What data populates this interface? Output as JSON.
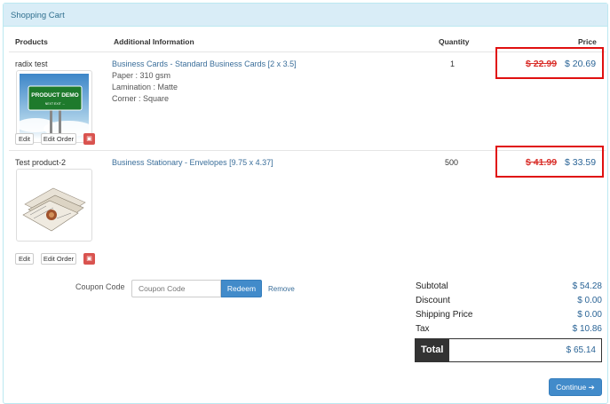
{
  "panel": {
    "title": "Shopping Cart"
  },
  "table": {
    "headers": {
      "products": "Products",
      "info": "Additional Information",
      "quantity": "Quantity",
      "price": "Price"
    },
    "rows": [
      {
        "name": "radix test",
        "thumb_text": "PRODUCT DEMO",
        "thumb_subtext": "NEXT EXIT →",
        "title": "Business Cards - Standard Business Cards [2 x 3.5]",
        "details": [
          "Paper : 310 gsm",
          "Lamination : Matte",
          "Corner : Square"
        ],
        "quantity": "1",
        "old_price": "$ 22.99",
        "new_price": "$ 20.69",
        "edit": "Edit",
        "edit_order": "Edit Order"
      },
      {
        "name": "Test product-2",
        "title": "Business Stationary - Envelopes [9.75 x 4.37]",
        "details": [],
        "quantity": "500",
        "old_price": "$ 41.99",
        "new_price": "$ 33.59",
        "edit": "Edit",
        "edit_order": "Edit Order"
      }
    ]
  },
  "coupon": {
    "label": "Coupon Code",
    "placeholder": "Coupon Code",
    "redeem": "Redeem",
    "remove": "Remove"
  },
  "summary": {
    "subtotal_label": "Subtotal",
    "subtotal": "$ 54.28",
    "discount_label": "Discount",
    "discount": "$ 0.00",
    "shipping_label": "Shipping Price",
    "shipping": "$ 0.00",
    "tax_label": "Tax",
    "tax": "$ 10.86",
    "total_label": "Total",
    "total": "$ 65.14"
  },
  "continue_label": "Continue ➔",
  "colors": {
    "accent": "#428bca",
    "heading_bg": "#d9edf7",
    "price_strike": "#d9302b",
    "highlight_border": "#e01010"
  }
}
